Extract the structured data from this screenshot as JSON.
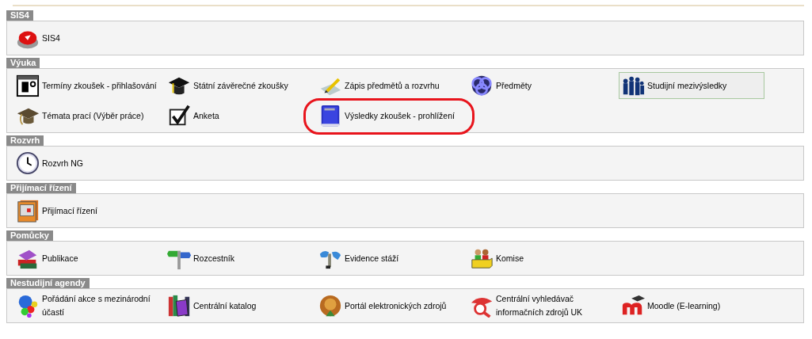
{
  "sections": [
    {
      "title": "SIS4",
      "items": [
        {
          "label": "SIS4",
          "highlighted": false,
          "circled": false
        }
      ]
    },
    {
      "title": "Výuka",
      "items": [
        {
          "label": "Termíny zkoušek - přihlašování",
          "highlighted": false,
          "circled": false
        },
        {
          "label": "Státní závěrečné zkoušky",
          "highlighted": false,
          "circled": false
        },
        {
          "label": "Zápis předmětů a rozvrhu",
          "highlighted": false,
          "circled": false
        },
        {
          "label": "Předměty",
          "highlighted": false,
          "circled": false
        },
        {
          "label": "Studijní mezivýsledky",
          "highlighted": true,
          "circled": false
        },
        {
          "label": "Témata prací (Výběr práce)",
          "highlighted": false,
          "circled": false
        },
        {
          "label": "Anketa",
          "highlighted": false,
          "circled": false
        },
        {
          "label": "Výsledky zkoušek - prohlížení",
          "highlighted": false,
          "circled": true
        }
      ]
    },
    {
      "title": "Rozvrh",
      "items": [
        {
          "label": "Rozvrh NG",
          "highlighted": false,
          "circled": false
        }
      ]
    },
    {
      "title": "Přijímací řízení",
      "items": [
        {
          "label": "Přijímací řízení",
          "highlighted": false,
          "circled": false
        }
      ]
    },
    {
      "title": "Pomůcky",
      "items": [
        {
          "label": "Publikace",
          "highlighted": false,
          "circled": false
        },
        {
          "label": "Rozcestník",
          "highlighted": false,
          "circled": false
        },
        {
          "label": "Evidence stáží",
          "highlighted": false,
          "circled": false
        },
        {
          "label": "Komise",
          "highlighted": false,
          "circled": false
        }
      ]
    },
    {
      "title": "Nestudijní agendy",
      "items": [
        {
          "label": "Pořádání akce s mezinárodní účastí",
          "highlighted": false,
          "circled": false
        },
        {
          "label": "Centrální katalog",
          "highlighted": false,
          "circled": false
        },
        {
          "label": "Portál elektronických zdrojů",
          "highlighted": false,
          "circled": false
        },
        {
          "label": "Centrální vyhledávač informačních zdrojů UK",
          "highlighted": false,
          "circled": false
        },
        {
          "label": "Moodle (E-learning)",
          "highlighted": false,
          "circled": false
        }
      ]
    }
  ]
}
